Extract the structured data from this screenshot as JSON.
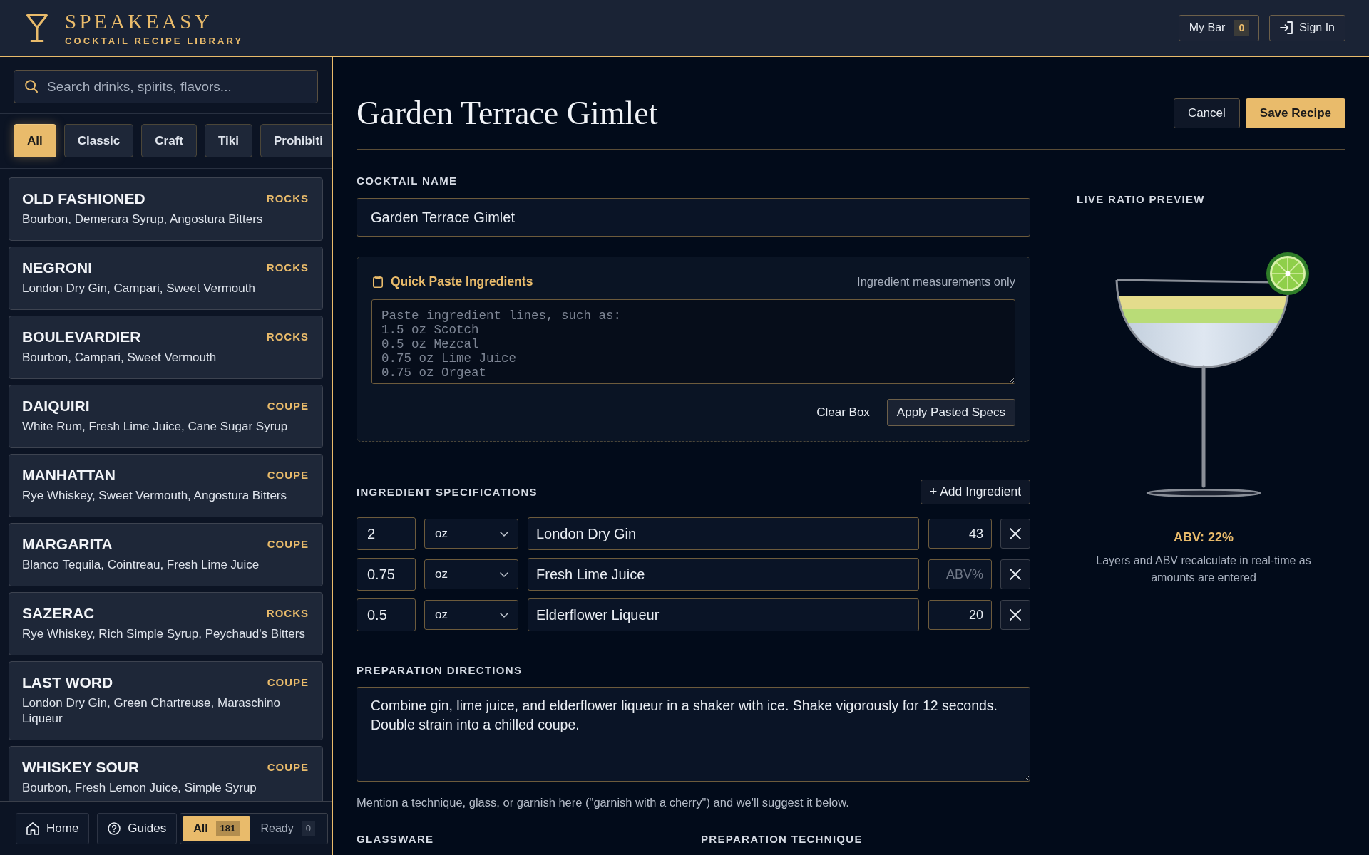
{
  "header": {
    "logo_title": "SPEAKEASY",
    "logo_subtitle": "COCKTAIL RECIPE LIBRARY",
    "my_bar": {
      "label": "My Bar",
      "count": "0"
    },
    "sign_in": {
      "label": "Sign In"
    }
  },
  "sidebar": {
    "search": {
      "placeholder": "Search drinks, spirits, flavors..."
    },
    "filters": [
      {
        "label": "All",
        "selected": true
      },
      {
        "label": "Classic",
        "selected": false
      },
      {
        "label": "Craft",
        "selected": false
      },
      {
        "label": "Tiki",
        "selected": false
      },
      {
        "label": "Prohibiti",
        "selected": false
      }
    ],
    "recipes": [
      {
        "name": "OLD FASHIONED",
        "glass": "ROCKS",
        "ingredients": "Bourbon, Demerara Syrup, Angostura Bitters"
      },
      {
        "name": "NEGRONI",
        "glass": "ROCKS",
        "ingredients": "London Dry Gin, Campari, Sweet Vermouth"
      },
      {
        "name": "BOULEVARDIER",
        "glass": "ROCKS",
        "ingredients": "Bourbon, Campari, Sweet Vermouth"
      },
      {
        "name": "DAIQUIRI",
        "glass": "COUPE",
        "ingredients": "White Rum, Fresh Lime Juice, Cane Sugar Syrup"
      },
      {
        "name": "MANHATTAN",
        "glass": "COUPE",
        "ingredients": "Rye Whiskey, Sweet Vermouth, Angostura Bitters"
      },
      {
        "name": "MARGARITA",
        "glass": "COUPE",
        "ingredients": "Blanco Tequila, Cointreau, Fresh Lime Juice"
      },
      {
        "name": "SAZERAC",
        "glass": "ROCKS",
        "ingredients": "Rye Whiskey, Rich Simple Syrup, Peychaud's Bitters"
      },
      {
        "name": "LAST WORD",
        "glass": "COUPE",
        "ingredients": "London Dry Gin, Green Chartreuse, Maraschino Liqueur"
      },
      {
        "name": "WHISKEY SOUR",
        "glass": "COUPE",
        "ingredients": "Bourbon, Fresh Lemon Juice, Simple Syrup"
      }
    ],
    "bottom_nav": {
      "links": [
        {
          "kind": "home",
          "label": "Home"
        },
        {
          "kind": "guides",
          "label": "Guides"
        }
      ],
      "segments": [
        {
          "label": "All",
          "count": "181",
          "selected": true
        },
        {
          "label": "Ready",
          "count": "0",
          "selected": false
        }
      ]
    }
  },
  "editor": {
    "title": "Garden Terrace Gimlet",
    "actions": [
      {
        "kind": "secondary",
        "label": "Cancel"
      },
      {
        "kind": "primary",
        "label": "Save Recipe"
      }
    ],
    "cocktail_name": {
      "label": "COCKTAIL NAME",
      "value": "Garden Terrace Gimlet"
    },
    "quick_paste": {
      "title": "Quick Paste Ingredients",
      "note": "Ingredient measurements only",
      "placeholder": "Paste ingredient lines, such as:\n1.5 oz Scotch\n0.5 oz Mezcal\n0.75 oz Lime Juice\n0.75 oz Orgeat",
      "buttons": [
        {
          "kind": "text",
          "label": "Clear Box"
        },
        {
          "kind": "outline",
          "label": "Apply Pasted Specs"
        }
      ]
    },
    "ingredients": {
      "label": "INGREDIENT SPECIFICATIONS",
      "add_button": "+ Add Ingredient",
      "rows": [
        {
          "amount": "2",
          "unit": "oz",
          "name": "London Dry Gin",
          "abv": "43"
        },
        {
          "amount": "0.75",
          "unit": "oz",
          "name": "Fresh Lime Juice",
          "abv_placeholder": "ABV%"
        },
        {
          "amount": "0.5",
          "unit": "oz",
          "name": "Elderflower Liqueur",
          "abv": "20"
        }
      ]
    },
    "directions": {
      "label": "PREPARATION DIRECTIONS",
      "value": "Combine gin, lime juice, and elderflower liqueur in a shaker with ice. Shake vigorously for 12 seconds. Double strain into a chilled coupe.",
      "hint": "Mention a technique, glass, or garnish here (\"garnish with a cherry\") and we'll suggest it below."
    },
    "glassware": {
      "label": "GLASSWARE"
    },
    "technique": {
      "label": "PREPARATION TECHNIQUE"
    }
  },
  "preview": {
    "title": "LIVE RATIO PREVIEW",
    "abv": "ABV: 22%",
    "note": "Layers and ABV recalculate in real-time as amounts are entered"
  }
}
